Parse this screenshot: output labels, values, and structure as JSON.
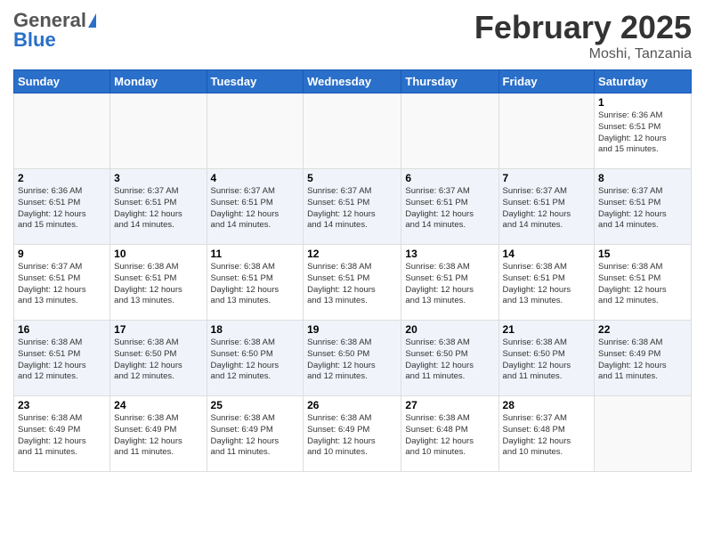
{
  "header": {
    "logo": {
      "line1": "General",
      "line2": "Blue"
    },
    "title": "February 2025",
    "location": "Moshi, Tanzania"
  },
  "columns": [
    "Sunday",
    "Monday",
    "Tuesday",
    "Wednesday",
    "Thursday",
    "Friday",
    "Saturday"
  ],
  "weeks": [
    {
      "days": [
        {
          "num": "",
          "info": ""
        },
        {
          "num": "",
          "info": ""
        },
        {
          "num": "",
          "info": ""
        },
        {
          "num": "",
          "info": ""
        },
        {
          "num": "",
          "info": ""
        },
        {
          "num": "",
          "info": ""
        },
        {
          "num": "1",
          "info": "Sunrise: 6:36 AM\nSunset: 6:51 PM\nDaylight: 12 hours\nand 15 minutes."
        }
      ]
    },
    {
      "days": [
        {
          "num": "2",
          "info": "Sunrise: 6:36 AM\nSunset: 6:51 PM\nDaylight: 12 hours\nand 15 minutes."
        },
        {
          "num": "3",
          "info": "Sunrise: 6:37 AM\nSunset: 6:51 PM\nDaylight: 12 hours\nand 14 minutes."
        },
        {
          "num": "4",
          "info": "Sunrise: 6:37 AM\nSunset: 6:51 PM\nDaylight: 12 hours\nand 14 minutes."
        },
        {
          "num": "5",
          "info": "Sunrise: 6:37 AM\nSunset: 6:51 PM\nDaylight: 12 hours\nand 14 minutes."
        },
        {
          "num": "6",
          "info": "Sunrise: 6:37 AM\nSunset: 6:51 PM\nDaylight: 12 hours\nand 14 minutes."
        },
        {
          "num": "7",
          "info": "Sunrise: 6:37 AM\nSunset: 6:51 PM\nDaylight: 12 hours\nand 14 minutes."
        },
        {
          "num": "8",
          "info": "Sunrise: 6:37 AM\nSunset: 6:51 PM\nDaylight: 12 hours\nand 14 minutes."
        }
      ]
    },
    {
      "days": [
        {
          "num": "9",
          "info": "Sunrise: 6:37 AM\nSunset: 6:51 PM\nDaylight: 12 hours\nand 13 minutes."
        },
        {
          "num": "10",
          "info": "Sunrise: 6:38 AM\nSunset: 6:51 PM\nDaylight: 12 hours\nand 13 minutes."
        },
        {
          "num": "11",
          "info": "Sunrise: 6:38 AM\nSunset: 6:51 PM\nDaylight: 12 hours\nand 13 minutes."
        },
        {
          "num": "12",
          "info": "Sunrise: 6:38 AM\nSunset: 6:51 PM\nDaylight: 12 hours\nand 13 minutes."
        },
        {
          "num": "13",
          "info": "Sunrise: 6:38 AM\nSunset: 6:51 PM\nDaylight: 12 hours\nand 13 minutes."
        },
        {
          "num": "14",
          "info": "Sunrise: 6:38 AM\nSunset: 6:51 PM\nDaylight: 12 hours\nand 13 minutes."
        },
        {
          "num": "15",
          "info": "Sunrise: 6:38 AM\nSunset: 6:51 PM\nDaylight: 12 hours\nand 12 minutes."
        }
      ]
    },
    {
      "days": [
        {
          "num": "16",
          "info": "Sunrise: 6:38 AM\nSunset: 6:51 PM\nDaylight: 12 hours\nand 12 minutes."
        },
        {
          "num": "17",
          "info": "Sunrise: 6:38 AM\nSunset: 6:50 PM\nDaylight: 12 hours\nand 12 minutes."
        },
        {
          "num": "18",
          "info": "Sunrise: 6:38 AM\nSunset: 6:50 PM\nDaylight: 12 hours\nand 12 minutes."
        },
        {
          "num": "19",
          "info": "Sunrise: 6:38 AM\nSunset: 6:50 PM\nDaylight: 12 hours\nand 12 minutes."
        },
        {
          "num": "20",
          "info": "Sunrise: 6:38 AM\nSunset: 6:50 PM\nDaylight: 12 hours\nand 11 minutes."
        },
        {
          "num": "21",
          "info": "Sunrise: 6:38 AM\nSunset: 6:50 PM\nDaylight: 12 hours\nand 11 minutes."
        },
        {
          "num": "22",
          "info": "Sunrise: 6:38 AM\nSunset: 6:49 PM\nDaylight: 12 hours\nand 11 minutes."
        }
      ]
    },
    {
      "days": [
        {
          "num": "23",
          "info": "Sunrise: 6:38 AM\nSunset: 6:49 PM\nDaylight: 12 hours\nand 11 minutes."
        },
        {
          "num": "24",
          "info": "Sunrise: 6:38 AM\nSunset: 6:49 PM\nDaylight: 12 hours\nand 11 minutes."
        },
        {
          "num": "25",
          "info": "Sunrise: 6:38 AM\nSunset: 6:49 PM\nDaylight: 12 hours\nand 11 minutes."
        },
        {
          "num": "26",
          "info": "Sunrise: 6:38 AM\nSunset: 6:49 PM\nDaylight: 12 hours\nand 10 minutes."
        },
        {
          "num": "27",
          "info": "Sunrise: 6:38 AM\nSunset: 6:48 PM\nDaylight: 12 hours\nand 10 minutes."
        },
        {
          "num": "28",
          "info": "Sunrise: 6:37 AM\nSunset: 6:48 PM\nDaylight: 12 hours\nand 10 minutes."
        },
        {
          "num": "",
          "info": ""
        }
      ]
    }
  ]
}
